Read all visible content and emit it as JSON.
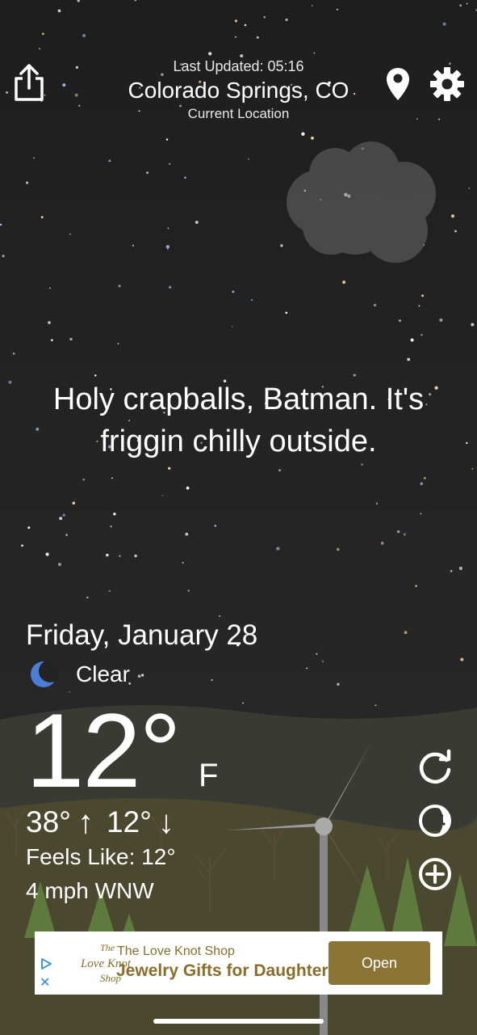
{
  "header": {
    "last_updated": "Last Updated: 05:16",
    "city": "Colorado Springs, CO",
    "subtitle": "Current Location"
  },
  "icons": {
    "share": "share-icon",
    "location": "location-pin-icon",
    "settings": "gear-icon",
    "refresh": "refresh-icon",
    "moon_phase": "moon-phase-icon",
    "add": "add-circle-icon",
    "condition": "crescent-moon-icon"
  },
  "phrase": "Holy crapballs, Batman. It's friggin chilly outside.",
  "weather": {
    "date": "Friday, January 28",
    "condition": "Clear",
    "temperature": "12°",
    "unit": "F",
    "high": "38°",
    "high_arrow": "↑",
    "low": "12°",
    "low_arrow": "↓",
    "feels_like": "Feels Like: 12°",
    "wind": "4 mph WNW"
  },
  "ad": {
    "shop_name": "The Love Knot Shop",
    "title": "Jewelry Gifts for Daughter",
    "button": "Open",
    "logo_text": "The Love Knot Shop"
  },
  "colors": {
    "background": "#222222",
    "ad_accent": "#8a6d2b",
    "ad_button": "#8a7537",
    "moon_icon": "#4a7fd6"
  }
}
